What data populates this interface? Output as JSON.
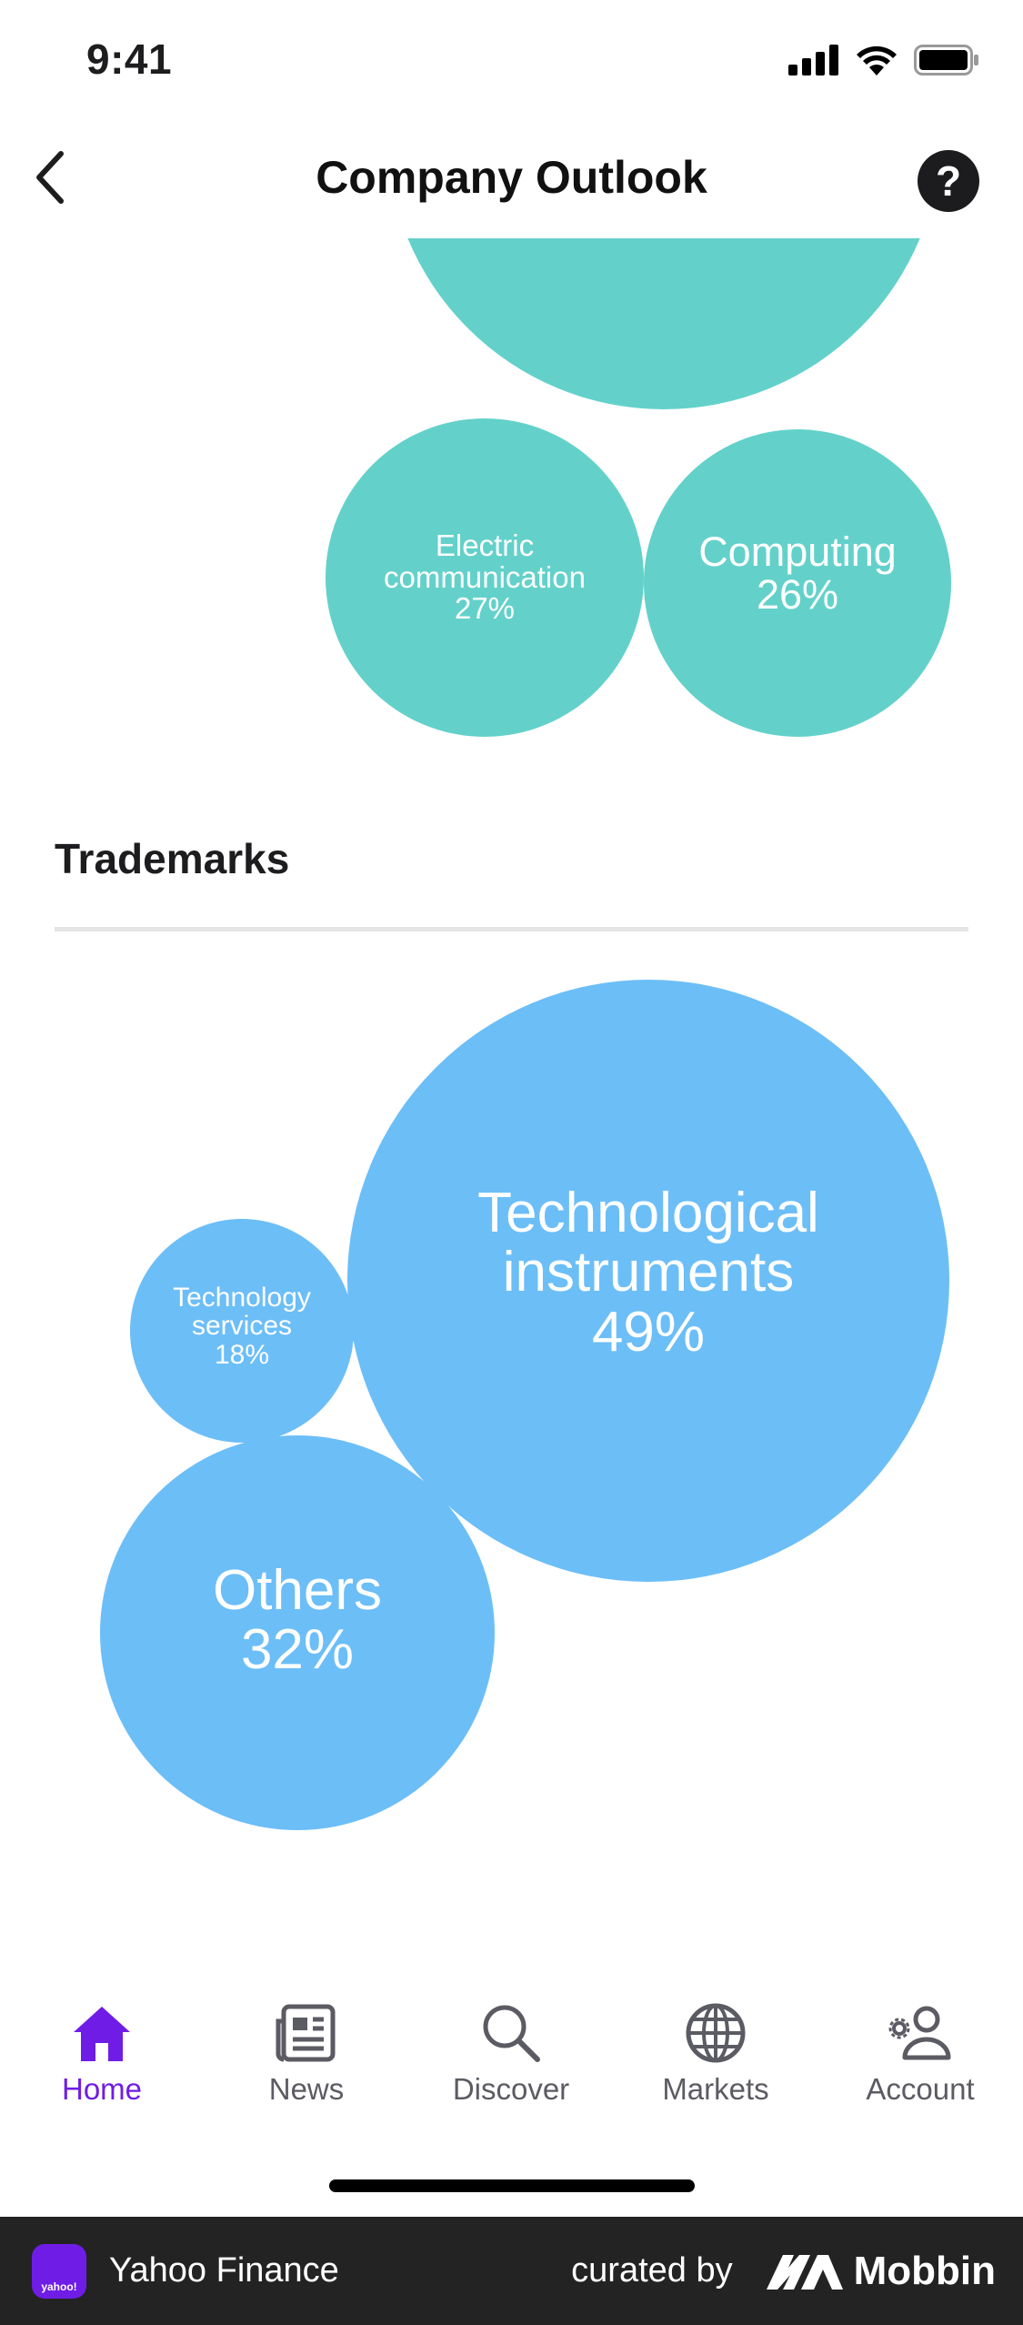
{
  "status_bar": {
    "time": "9:41"
  },
  "header": {
    "title": "Company Outlook",
    "help_label": "?"
  },
  "patents_chart": {
    "bubbles": [
      {
        "label": "",
        "value": ""
      },
      {
        "label": "Electric communication",
        "value": "27%"
      },
      {
        "label": "Computing",
        "value": "26%"
      }
    ]
  },
  "trademarks": {
    "title": "Trademarks",
    "bubbles": [
      {
        "label": "Technological instruments",
        "value": "49%"
      },
      {
        "label": "Technology services",
        "value": "18%"
      },
      {
        "label": "Others",
        "value": "32%"
      }
    ]
  },
  "tab_bar": {
    "tabs": [
      {
        "label": "Home",
        "icon": "home-icon",
        "active": true
      },
      {
        "label": "News",
        "icon": "news-icon",
        "active": false
      },
      {
        "label": "Discover",
        "icon": "search-icon",
        "active": false
      },
      {
        "label": "Markets",
        "icon": "globe-icon",
        "active": false
      },
      {
        "label": "Account",
        "icon": "account-icon",
        "active": false
      }
    ]
  },
  "footer": {
    "app_name": "Yahoo Finance",
    "app_badge_text": "yahoo!",
    "curated_by": "curated by",
    "brand": "Mobbin"
  },
  "colors": {
    "teal": "#63d1ca",
    "blue": "#6cbef7",
    "accent": "#6f1de6"
  }
}
